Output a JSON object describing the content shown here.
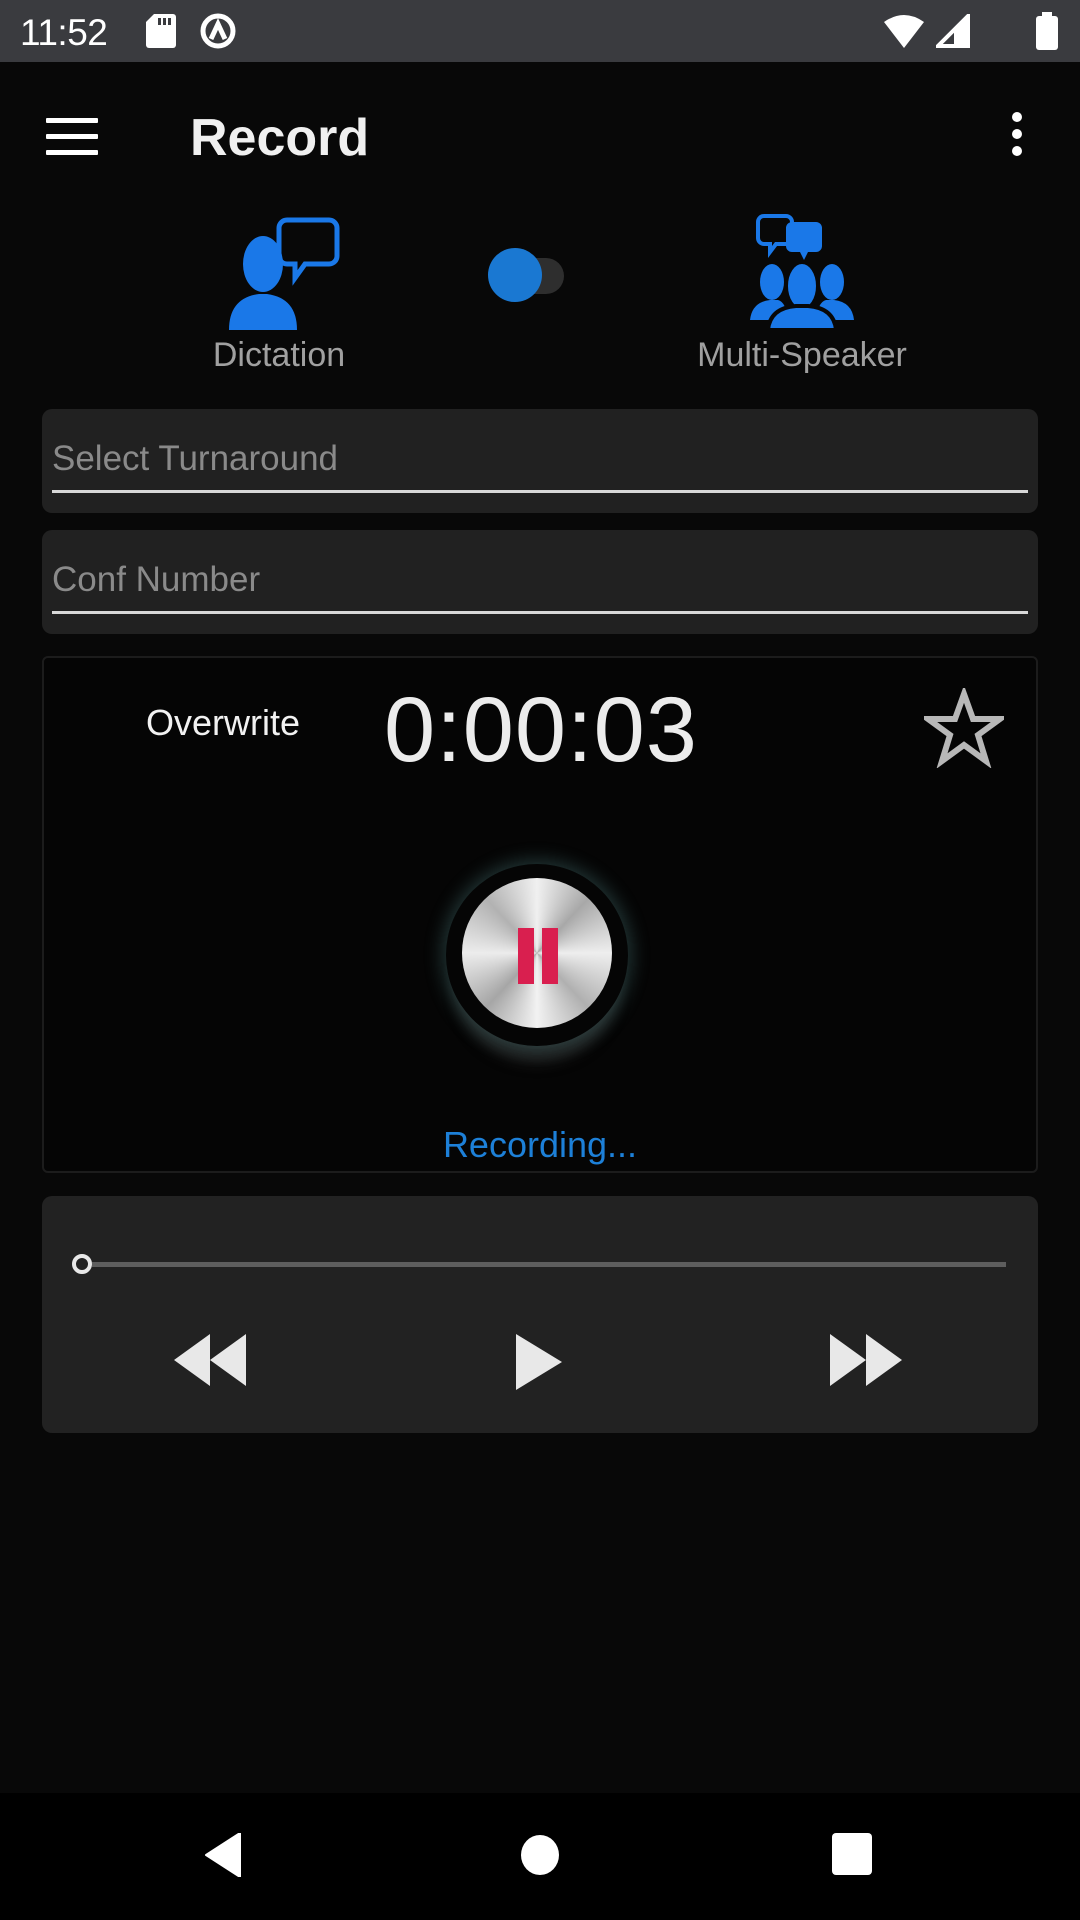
{
  "status_bar": {
    "time": "11:52",
    "icons": [
      "sd-card-icon",
      "vpn-key-icon",
      "wifi-icon",
      "cell-signal-icon",
      "battery-icon"
    ]
  },
  "app_bar": {
    "title": "Record",
    "menu_icon": "hamburger-menu-icon",
    "overflow_icon": "more-vert-icon"
  },
  "mode_switch": {
    "left_label": "Dictation",
    "right_label": "Multi-Speaker",
    "selected": "Dictation",
    "toggle_on": false,
    "accent_color": "#1a78d2"
  },
  "fields": {
    "turnaround": {
      "placeholder": "Select Turnaround",
      "value": ""
    },
    "conf_number": {
      "placeholder": "Conf Number",
      "value": ""
    }
  },
  "recorder": {
    "mode_label": "Overwrite",
    "elapsed": "0:00:03",
    "favorite": false,
    "button_state": "pause",
    "status": "Recording...",
    "status_color": "#1d80d8",
    "pause_color": "#d91f4f"
  },
  "player": {
    "progress": 0,
    "controls": [
      "rewind",
      "play",
      "fast-forward"
    ]
  },
  "nav_bar": {
    "buttons": [
      "back",
      "home",
      "recents"
    ]
  }
}
